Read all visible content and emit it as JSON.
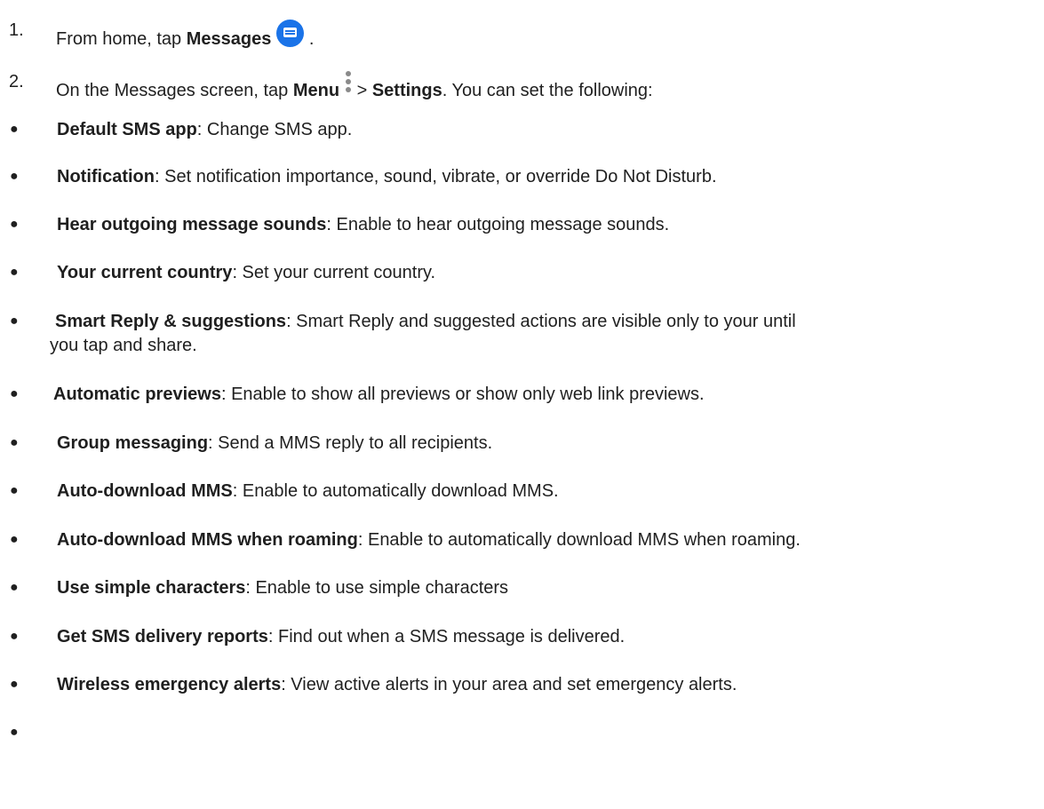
{
  "steps": [
    {
      "num": "1.",
      "prefix": "From home, tap ",
      "bold": "Messages",
      "suffix": " ."
    },
    {
      "num": "2.",
      "prefix": "On the Messages screen, tap ",
      "bold": "Menu",
      "middle": " > ",
      "bold2": "Settings",
      "suffix": ". You can set the following:"
    }
  ],
  "icons": {
    "messages": "messages-app-icon",
    "menu": "more-vert-icon",
    "bullet": "●"
  },
  "settings": [
    {
      "title": "Default SMS app",
      "desc": ": Change SMS app."
    },
    {
      "title": "Notification",
      "desc": ": Set notification importance, sound, vibrate, or override Do Not Disturb."
    },
    {
      "title": "Hear outgoing message sounds",
      "desc": ": Enable to hear outgoing message sounds."
    },
    {
      "title": "Your current country",
      "desc": ": Set your current country."
    },
    {
      "title": "Smart Reply & suggestions",
      "desc": ": Smart Reply and suggested actions are visible only to your until",
      "desc2": "you tap and share."
    },
    {
      "title": "Automatic previews",
      "desc": ": Enable to show all previews or show only web link previews."
    },
    {
      "title": "Group messaging",
      "desc": ": Send a MMS reply to all recipients."
    },
    {
      "title": "Auto-download MMS",
      "desc": ": Enable to automatically download MMS."
    },
    {
      "title": "Auto-download MMS when roaming",
      "desc": ": Enable to automatically download MMS when roaming."
    },
    {
      "title": "Use simple characters",
      "desc": ": Enable to use simple characters"
    },
    {
      "title": "Get SMS delivery reports",
      "desc": ": Find out when a SMS message is delivered."
    },
    {
      "title": "Wireless emergency alerts",
      "desc": ": View active alerts in your area and set emergency alerts."
    }
  ]
}
